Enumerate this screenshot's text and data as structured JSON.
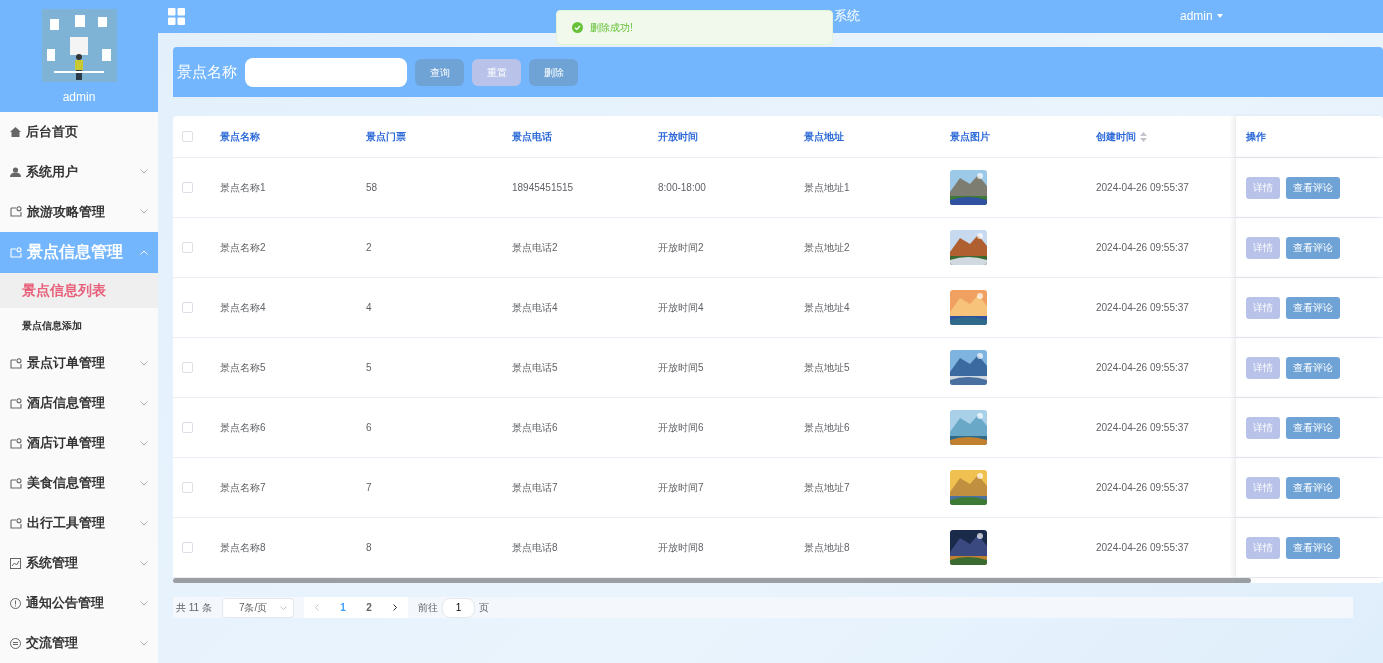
{
  "header": {
    "title_visible": "系统",
    "user": "admin"
  },
  "toast": {
    "message": "删除成功!"
  },
  "sidebar": {
    "user": "admin",
    "items": [
      {
        "kind": "home",
        "label": "后台首页",
        "expanded": false
      },
      {
        "kind": "user",
        "label": "系统用户",
        "expanded": false
      },
      {
        "kind": "module",
        "label": "旅游攻略管理",
        "expanded": false
      },
      {
        "kind": "module",
        "label": "景点信息管理",
        "expanded": true,
        "children": [
          {
            "label": "景点信息列表",
            "selected": true
          },
          {
            "label": "景点信息添加",
            "selected": false
          }
        ]
      },
      {
        "kind": "module",
        "label": "景点订单管理",
        "expanded": false
      },
      {
        "kind": "module",
        "label": "酒店信息管理",
        "expanded": false
      },
      {
        "kind": "module",
        "label": "酒店订单管理",
        "expanded": false
      },
      {
        "kind": "module",
        "label": "美食信息管理",
        "expanded": false
      },
      {
        "kind": "module",
        "label": "出行工具管理",
        "expanded": false
      },
      {
        "kind": "chart",
        "label": "系统管理",
        "expanded": false
      },
      {
        "kind": "notice",
        "label": "通知公告管理",
        "expanded": false
      },
      {
        "kind": "chat",
        "label": "交流管理",
        "expanded": false
      }
    ]
  },
  "search": {
    "label": "景点名称",
    "buttons": [
      "查询",
      "重置",
      "删除"
    ]
  },
  "table": {
    "select_all": {
      "checked": false
    },
    "columns": [
      {
        "label": "景点名称",
        "sortable": false
      },
      {
        "label": "景点门票",
        "sortable": false
      },
      {
        "label": "景点电话",
        "sortable": false
      },
      {
        "label": "开放时间",
        "sortable": false
      },
      {
        "label": "景点地址",
        "sortable": false
      },
      {
        "label": "景点图片",
        "sortable": false
      },
      {
        "label": "创建时间",
        "sortable": true
      },
      {
        "label": "操作",
        "sortable": false
      }
    ],
    "rows": [
      {
        "checked": false,
        "cells": [
          "景点名称1",
          "58",
          "18945451515",
          "8:00-18:00",
          "景点地址1"
        ],
        "image": {
          "kind": "picture"
        },
        "created": "2024-04-26 09:55:37",
        "actions": [
          "详情",
          "查看评论"
        ]
      },
      {
        "checked": false,
        "cells": [
          "景点名称2",
          "2",
          "景点电话2",
          "开放时间2",
          "景点地址2"
        ],
        "image": {
          "kind": "picture"
        },
        "created": "2024-04-26 09:55:37",
        "actions": [
          "详情",
          "查看评论"
        ]
      },
      {
        "checked": false,
        "cells": [
          "景点名称4",
          "4",
          "景点电话4",
          "开放时间4",
          "景点地址4"
        ],
        "image": {
          "kind": "picture"
        },
        "created": "2024-04-26 09:55:37",
        "actions": [
          "详情",
          "查看评论"
        ]
      },
      {
        "checked": false,
        "cells": [
          "景点名称5",
          "5",
          "景点电话5",
          "开放时间5",
          "景点地址5"
        ],
        "image": {
          "kind": "picture"
        },
        "created": "2024-04-26 09:55:37",
        "actions": [
          "详情",
          "查看评论"
        ]
      },
      {
        "checked": false,
        "cells": [
          "景点名称6",
          "6",
          "景点电话6",
          "开放时间6",
          "景点地址6"
        ],
        "image": {
          "kind": "picture"
        },
        "created": "2024-04-26 09:55:37",
        "actions": [
          "详情",
          "查看评论"
        ]
      },
      {
        "checked": false,
        "cells": [
          "景点名称7",
          "7",
          "景点电话7",
          "开放时间7",
          "景点地址7"
        ],
        "image": {
          "kind": "picture"
        },
        "created": "2024-04-26 09:55:37",
        "actions": [
          "详情",
          "查看评论"
        ]
      },
      {
        "checked": false,
        "cells": [
          "景点名称8",
          "8",
          "景点电话8",
          "开放时间8",
          "景点地址8"
        ],
        "image": {
          "kind": "picture"
        },
        "created": "2024-04-26 09:55:37",
        "actions": [
          "详情",
          "查看评论"
        ]
      }
    ]
  },
  "pagination": {
    "total": "共 11 条",
    "page_size": "7条/页",
    "pages": [
      {
        "label": "1",
        "selected": true
      },
      {
        "label": "2",
        "selected": false
      }
    ],
    "goto_label": "前往",
    "goto_value": "1",
    "goto_suffix": "页"
  }
}
